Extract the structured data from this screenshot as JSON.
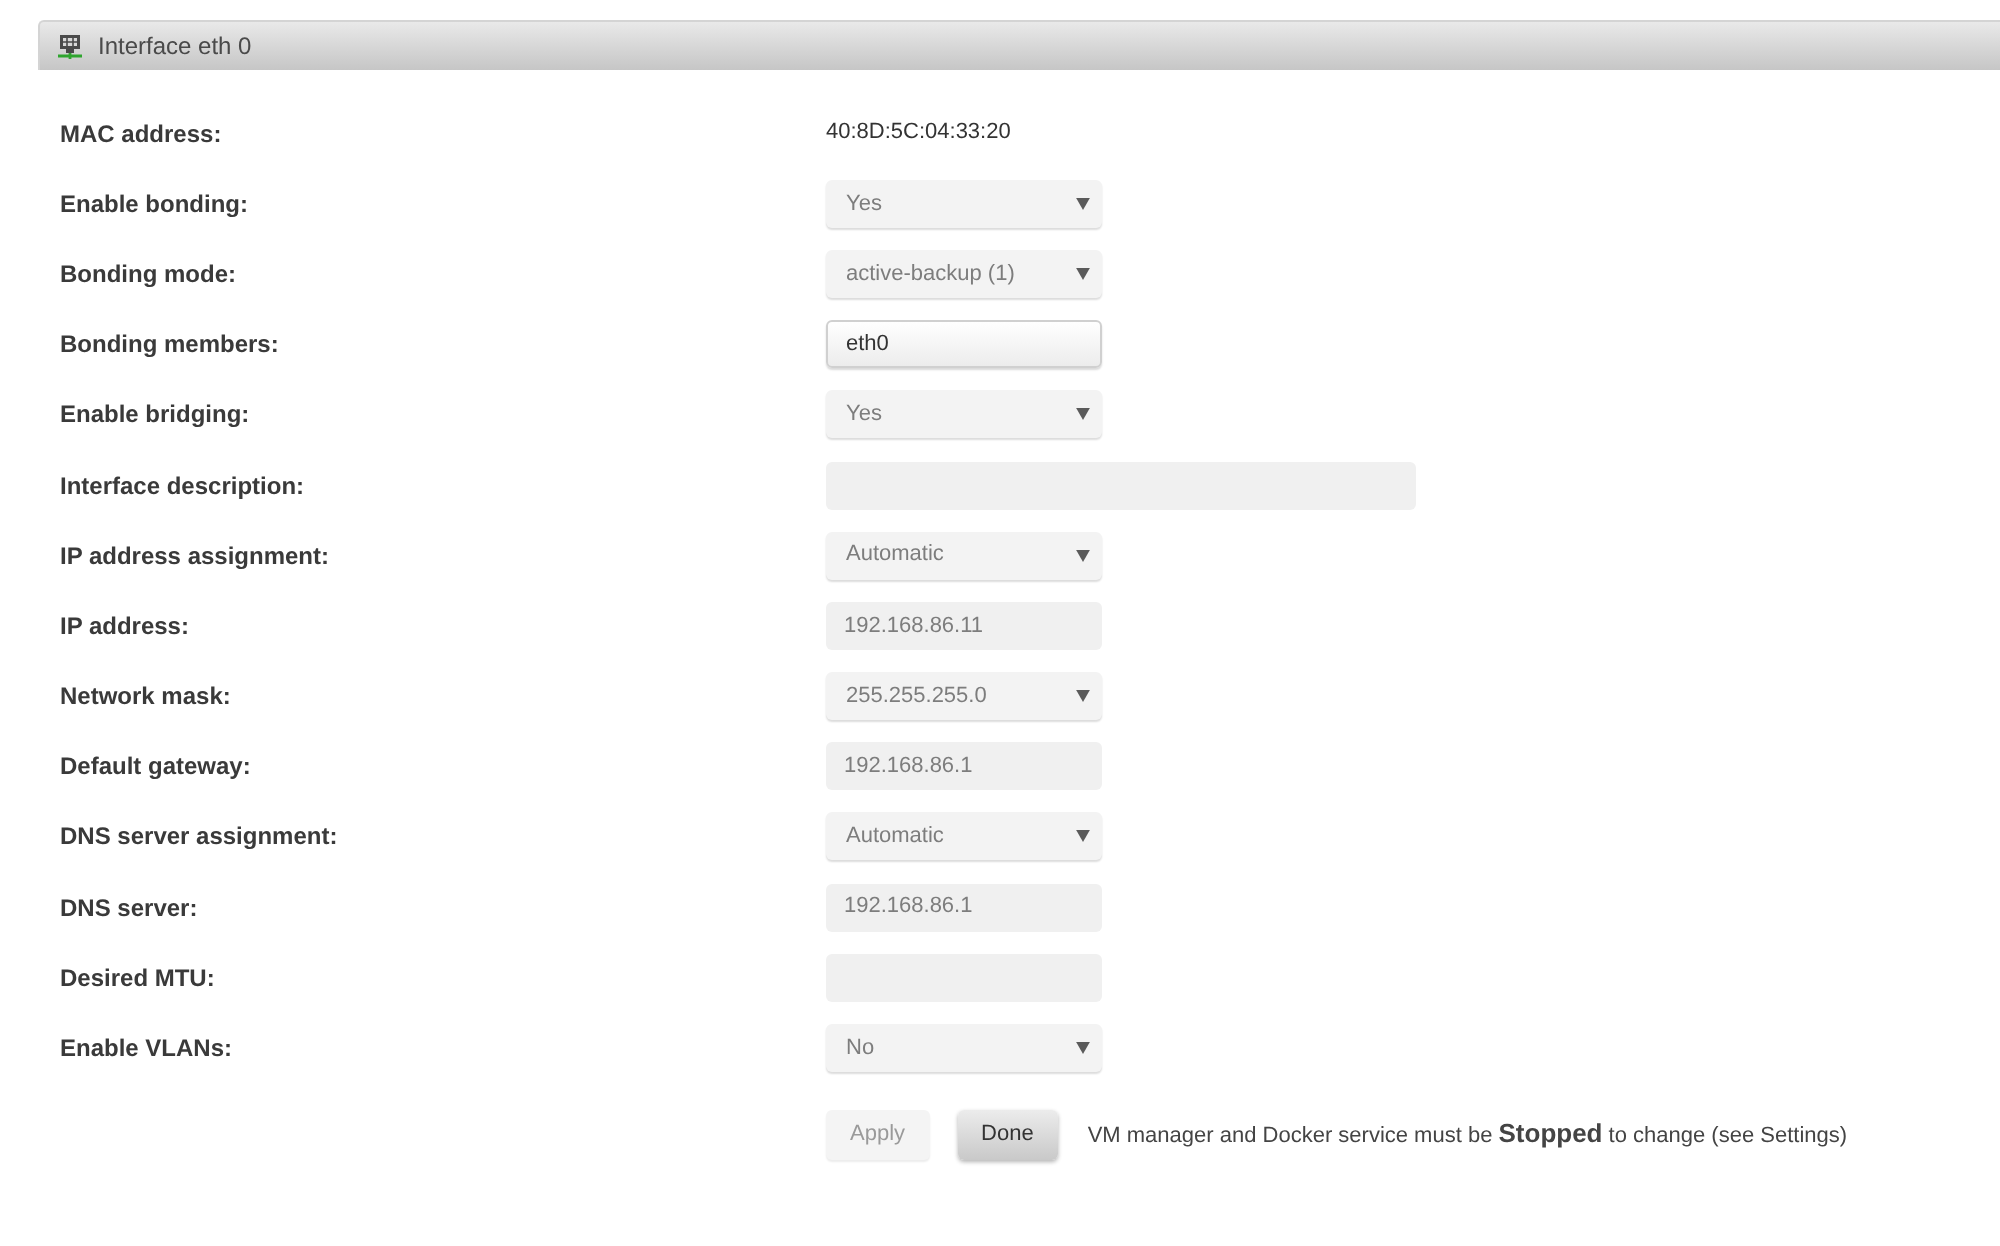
{
  "panel": {
    "title": "Interface eth 0"
  },
  "fields": [
    {
      "label": "MAC address:",
      "kind": "static",
      "value": "40:8D:5C:04:33:20",
      "disabled": false
    },
    {
      "label": "Enable bonding:",
      "kind": "select",
      "value": "Yes",
      "disabled": true
    },
    {
      "label": "Bonding mode:",
      "kind": "select",
      "value": "active-backup (1)",
      "disabled": true
    },
    {
      "label": "Bonding members:",
      "kind": "input",
      "value": "eth0",
      "disabled": false
    },
    {
      "label": "Enable bridging:",
      "kind": "select",
      "value": "Yes",
      "disabled": true
    },
    {
      "label": "Interface description:",
      "kind": "wideinput",
      "disabled": true
    },
    {
      "label": "IP address assignment:",
      "kind": "select",
      "value": "Automatic",
      "disabled": true
    },
    {
      "label": "IP address:",
      "kind": "input",
      "value": "192.168.86.11",
      "disabled": true
    },
    {
      "label": "Network mask:",
      "kind": "select",
      "value": "255.255.255.0",
      "disabled": true
    },
    {
      "label": "Default gateway:",
      "kind": "input",
      "value": "192.168.86.1",
      "disabled": true
    },
    {
      "label": "DNS server assignment:",
      "kind": "select",
      "value": "Automatic",
      "disabled": true
    },
    {
      "label": "DNS server:",
      "kind": "input",
      "value": "192.168.86.1",
      "disabled": true
    },
    {
      "label": "Desired MTU:",
      "kind": "input",
      "disabled": true
    },
    {
      "label": "Enable VLANs:",
      "kind": "select",
      "value": "No",
      "disabled": true
    }
  ],
  "buttons": [
    {
      "label": "Apply",
      "disabled": true
    },
    {
      "label": "Done",
      "disabled": false
    }
  ],
  "note": "VM manager and Docker service must be **Stopped** to change (see Settings)"
}
